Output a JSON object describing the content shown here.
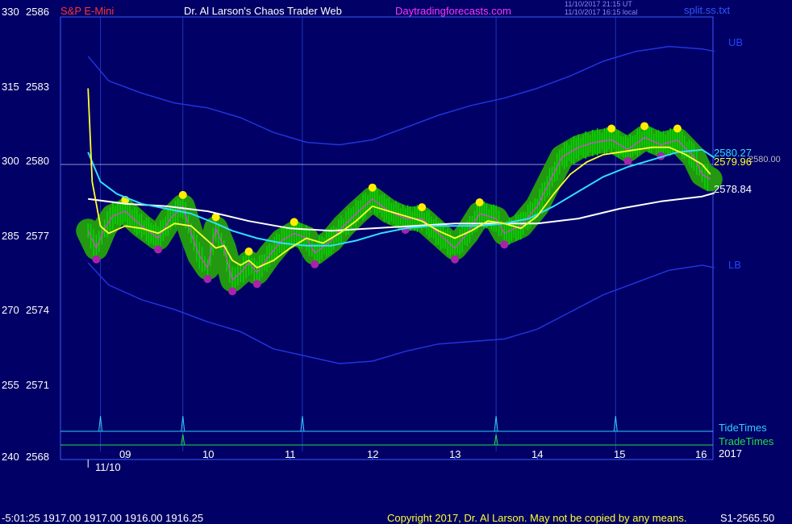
{
  "header": {
    "instrument": "S&P E-Mini",
    "site": "Dr. Al Larson's Chaos Trader Web",
    "url": "Daytradingforecasts.com",
    "stamp_utc": "11/10/2017 21:15 UT",
    "stamp_local": "11/10/2017 16:15 local",
    "file": "split.ss.txt"
  },
  "footer": {
    "readout": "-5:01:25  1917.00 1917.00 1916.00 1916.25",
    "copyright": "Copyright 2017, Dr. Al Larson. May not be copied by any means.",
    "code": "S1-2565.50"
  },
  "colors": {
    "background": "#000066",
    "axis": "#3a5cff",
    "price_candles": "#00dd00",
    "highlight_glow": "#229911",
    "high_marker": "#ffee00",
    "low_marker": "#aa22aa",
    "fast_avg": "#ffff33",
    "mid_avg": "#33ddff",
    "slow_avg": "#ffffff",
    "bands": "#2233dd",
    "tide": "#33ccff",
    "trade": "#22dd44"
  },
  "chart_data": {
    "type": "line",
    "title": "S&P E-Mini",
    "x_unit": "hour of day",
    "x_ticks": [
      "09",
      "10",
      "11",
      "12",
      "13",
      "14",
      "15",
      "16"
    ],
    "date_label": "11/10",
    "year_label": "2017",
    "y_left_ticks": [
      "330",
      "315",
      "300",
      "285",
      "270",
      "255",
      "240"
    ],
    "y_price_ticks": [
      "2586",
      "2583",
      "2580",
      "2577",
      "2574",
      "2571",
      "2568"
    ],
    "ylim": [
      2568,
      2586
    ],
    "reference_price": 2580,
    "band_labels": {
      "upper": "UB",
      "lower": "LB"
    },
    "right_labels": [
      "2580.27",
      "2579.96",
      "2580.00",
      "2578.84"
    ],
    "series": [
      {
        "name": "Price",
        "x": [
          8.55,
          8.65,
          8.75,
          8.85,
          9.0,
          9.2,
          9.4,
          9.55,
          9.7,
          9.8,
          9.9,
          10.0,
          10.1,
          10.2,
          10.3,
          10.4,
          10.5,
          10.6,
          10.75,
          10.9,
          11.05,
          11.2,
          11.3,
          11.5,
          11.65,
          11.8,
          12.0,
          12.2,
          12.4,
          12.6,
          12.8,
          13.0,
          13.15,
          13.3,
          13.5,
          13.6,
          13.8,
          14.0,
          14.15,
          14.3,
          14.5,
          14.7,
          14.9,
          15.1,
          15.3,
          15.5,
          15.7,
          15.9,
          16.0,
          16.1
        ],
        "y": [
          2577.3,
          2576.6,
          2577.4,
          2577.9,
          2578.1,
          2577.5,
          2577.0,
          2577.8,
          2578.3,
          2577.2,
          2576.3,
          2575.8,
          2577.4,
          2576.6,
          2575.3,
          2575.6,
          2576.0,
          2575.6,
          2576.3,
          2576.9,
          2577.2,
          2577.0,
          2576.4,
          2576.9,
          2577.5,
          2578.0,
          2578.6,
          2578.1,
          2577.8,
          2577.8,
          2577.2,
          2576.6,
          2577.2,
          2578.0,
          2577.8,
          2577.2,
          2577.5,
          2578.3,
          2579.3,
          2580.3,
          2580.7,
          2580.9,
          2581.0,
          2580.6,
          2581.1,
          2580.8,
          2581.0,
          2580.3,
          2579.6,
          2579.4
        ]
      },
      {
        "name": "Fast average",
        "x": [
          8.55,
          8.6,
          8.7,
          8.8,
          9.0,
          9.2,
          9.4,
          9.6,
          9.8,
          10.0,
          10.1,
          10.2,
          10.3,
          10.4,
          10.5,
          10.6,
          10.8,
          11.0,
          11.2,
          11.4,
          11.6,
          11.8,
          12.0,
          12.2,
          12.4,
          12.6,
          12.8,
          13.0,
          13.2,
          13.4,
          13.6,
          13.8,
          14.0,
          14.2,
          14.4,
          14.6,
          14.8,
          15.0,
          15.2,
          15.4,
          15.6,
          15.8,
          16.0,
          16.1
        ],
        "y": [
          2583.1,
          2579.3,
          2577.5,
          2577.2,
          2577.5,
          2577.4,
          2577.2,
          2577.6,
          2577.5,
          2576.9,
          2576.6,
          2576.7,
          2576.1,
          2575.9,
          2576.1,
          2575.8,
          2576.1,
          2576.6,
          2577.0,
          2576.8,
          2577.2,
          2577.7,
          2578.3,
          2578.1,
          2577.9,
          2577.7,
          2577.3,
          2577.0,
          2577.3,
          2577.7,
          2577.6,
          2577.4,
          2577.9,
          2578.8,
          2579.6,
          2580.1,
          2580.4,
          2580.5,
          2580.6,
          2580.7,
          2580.7,
          2580.4,
          2580.0,
          2579.6
        ]
      },
      {
        "name": "Mid average",
        "x": [
          8.55,
          8.7,
          8.9,
          9.2,
          9.5,
          9.8,
          10.1,
          10.3,
          10.6,
          10.9,
          11.2,
          11.5,
          11.8,
          12.1,
          12.4,
          12.7,
          13.0,
          13.3,
          13.6,
          13.9,
          14.2,
          14.5,
          14.8,
          15.1,
          15.4,
          15.7,
          16.0,
          16.15
        ],
        "y": [
          2580.5,
          2579.3,
          2578.8,
          2578.4,
          2578.2,
          2578.0,
          2577.6,
          2577.3,
          2577.0,
          2576.8,
          2576.7,
          2576.7,
          2576.9,
          2577.2,
          2577.4,
          2577.5,
          2577.5,
          2577.5,
          2577.6,
          2577.8,
          2578.3,
          2578.9,
          2579.5,
          2579.9,
          2580.2,
          2580.5,
          2580.6,
          2580.27
        ]
      },
      {
        "name": "Slow average",
        "x": [
          8.55,
          9.0,
          9.5,
          10.0,
          10.5,
          11.0,
          11.5,
          12.0,
          12.5,
          13.0,
          13.5,
          14.0,
          14.5,
          15.0,
          15.5,
          16.0,
          16.15
        ],
        "y": [
          2578.6,
          2578.4,
          2578.3,
          2578.1,
          2577.7,
          2577.4,
          2577.3,
          2577.4,
          2577.5,
          2577.6,
          2577.6,
          2577.6,
          2577.8,
          2578.2,
          2578.5,
          2578.7,
          2578.84
        ]
      },
      {
        "name": "UB",
        "x": [
          8.55,
          8.8,
          9.2,
          9.6,
          10.0,
          10.4,
          10.8,
          11.2,
          11.6,
          12.0,
          12.4,
          12.8,
          13.2,
          13.6,
          14.0,
          14.4,
          14.8,
          15.2,
          15.6,
          16.0,
          16.15
        ],
        "y": [
          2584.4,
          2583.4,
          2582.9,
          2582.5,
          2582.3,
          2581.9,
          2581.3,
          2580.9,
          2580.8,
          2581.0,
          2581.5,
          2582.0,
          2582.4,
          2582.7,
          2583.1,
          2583.6,
          2584.2,
          2584.6,
          2584.8,
          2584.7,
          2584.6
        ]
      },
      {
        "name": "LB",
        "x": [
          8.55,
          8.8,
          9.2,
          9.6,
          10.0,
          10.4,
          10.8,
          11.2,
          11.6,
          12.0,
          12.4,
          12.8,
          13.2,
          13.6,
          14.0,
          14.4,
          14.8,
          15.2,
          15.6,
          16.0,
          16.15
        ],
        "y": [
          2576.0,
          2575.1,
          2574.5,
          2574.1,
          2573.6,
          2573.2,
          2572.5,
          2572.2,
          2571.9,
          2572.0,
          2572.4,
          2572.7,
          2572.8,
          2572.9,
          2573.3,
          2574.0,
          2574.7,
          2575.2,
          2575.7,
          2575.9,
          2575.8
        ]
      }
    ],
    "tide_times": [
      8.7,
      9.7,
      11.15,
      13.5,
      14.95
    ],
    "trade_times": [
      9.7,
      13.5
    ],
    "grid": false
  }
}
